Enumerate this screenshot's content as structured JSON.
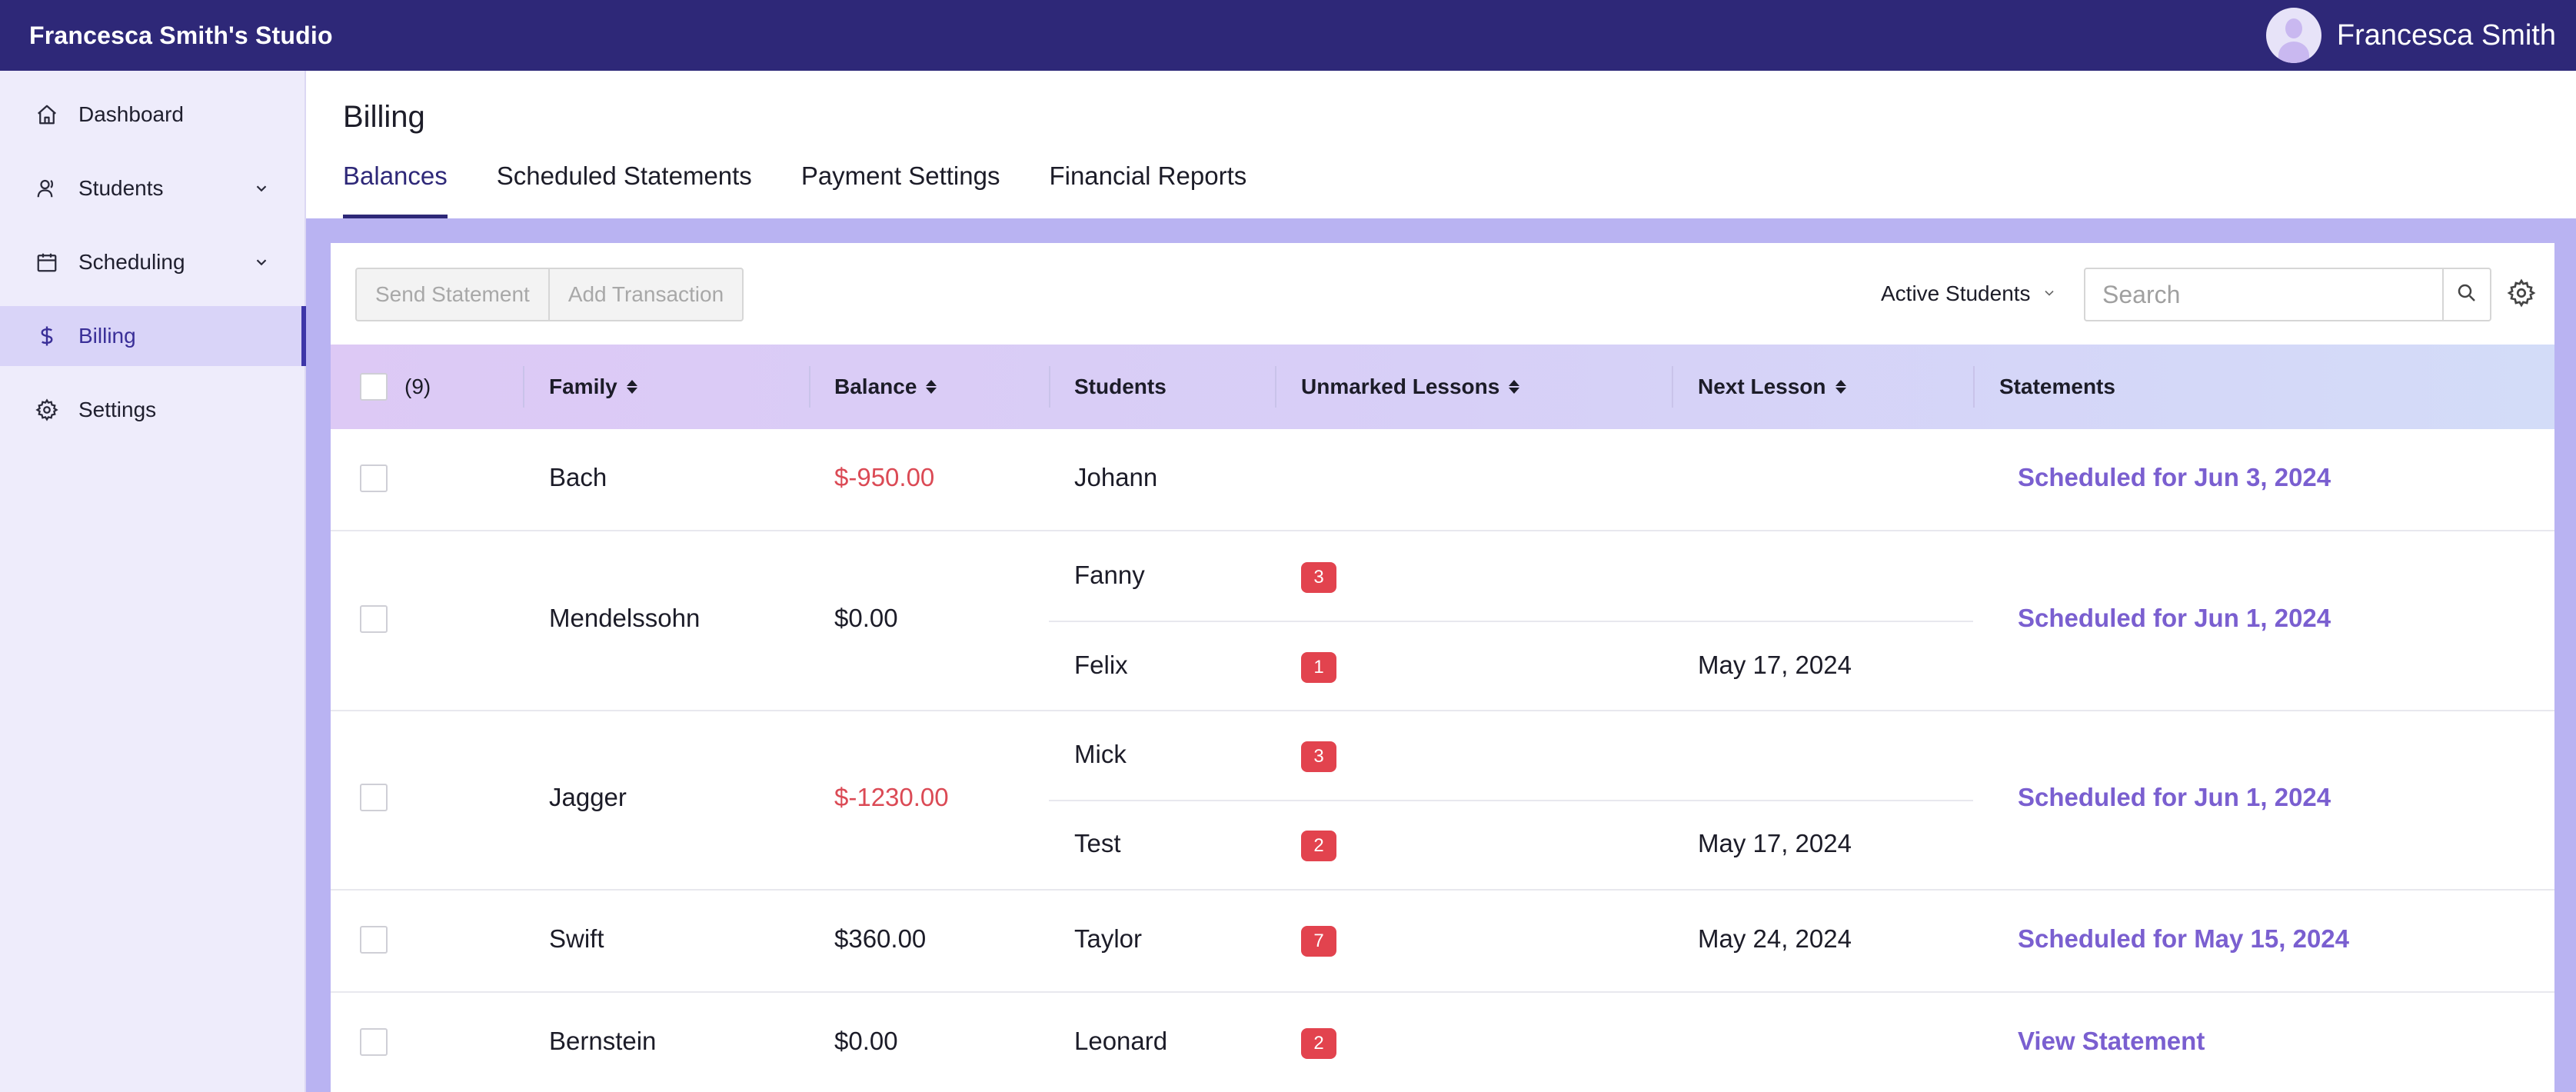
{
  "app": {
    "studio_name": "Francesca Smith's Studio",
    "user_name": "Francesca Smith"
  },
  "sidebar": {
    "items": [
      {
        "label": "Dashboard",
        "icon": "home-icon"
      },
      {
        "label": "Students",
        "icon": "person-icon",
        "expandable": true
      },
      {
        "label": "Scheduling",
        "icon": "calendar-icon",
        "expandable": true
      },
      {
        "label": "Billing",
        "icon": "dollar-icon",
        "active": true
      },
      {
        "label": "Settings",
        "icon": "gear-icon"
      }
    ]
  },
  "page": {
    "title": "Billing",
    "tabs": [
      {
        "label": "Balances",
        "active": true
      },
      {
        "label": "Scheduled Statements"
      },
      {
        "label": "Payment Settings"
      },
      {
        "label": "Financial Reports"
      }
    ]
  },
  "toolbar": {
    "send_statement": "Send Statement",
    "add_transaction": "Add Transaction",
    "filter_label": "Active Students",
    "search_placeholder": "Search"
  },
  "table": {
    "select_count": "(9)",
    "headers": {
      "family": "Family",
      "balance": "Balance",
      "students": "Students",
      "unmarked": "Unmarked Lessons",
      "next_lesson": "Next Lesson",
      "statements": "Statements"
    },
    "rows": [
      {
        "family": "Bach",
        "balance": "$-950.00",
        "negative": true,
        "students": [
          {
            "name": "Johann",
            "unmarked": "",
            "next": ""
          }
        ],
        "statement": "Scheduled for Jun 3, 2024"
      },
      {
        "family": "Mendelssohn",
        "balance": "$0.00",
        "negative": false,
        "students": [
          {
            "name": "Fanny",
            "unmarked": "3",
            "next": ""
          },
          {
            "name": "Felix",
            "unmarked": "1",
            "next": "May 17, 2024"
          }
        ],
        "statement": "Scheduled for Jun 1, 2024"
      },
      {
        "family": "Jagger",
        "balance": "$-1230.00",
        "negative": true,
        "students": [
          {
            "name": "Mick",
            "unmarked": "3",
            "next": ""
          },
          {
            "name": "Test",
            "unmarked": "2",
            "next": "May 17, 2024"
          }
        ],
        "statement": "Scheduled for Jun 1, 2024"
      },
      {
        "family": "Swift",
        "balance": "$360.00",
        "negative": false,
        "students": [
          {
            "name": "Taylor",
            "unmarked": "7",
            "next": "May 24, 2024"
          }
        ],
        "statement": "Scheduled for May 15, 2024"
      },
      {
        "family": "Bernstein",
        "balance": "$0.00",
        "negative": false,
        "students": [
          {
            "name": "Leonard",
            "unmarked": "2",
            "next": ""
          }
        ],
        "statement": "View Statement"
      }
    ]
  },
  "colors": {
    "topbar": "#2e2878",
    "accent": "#3d35a8",
    "link": "#7a5fd0",
    "negative": "#db4a55",
    "badge": "#e2434e",
    "content_bg": "#b9b3f2"
  }
}
